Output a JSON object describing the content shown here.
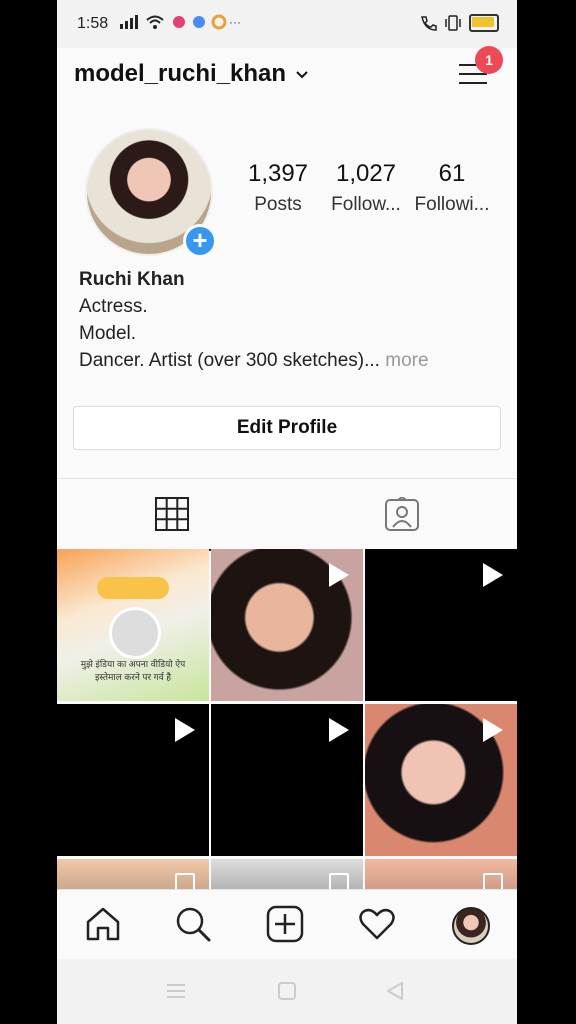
{
  "status_bar": {
    "time": "1:58"
  },
  "profile": {
    "username": "model_ruchi_khan",
    "notification_count": "1",
    "stats": [
      {
        "value": "1,397",
        "label": "Posts"
      },
      {
        "value": "1,027",
        "label": "Follow..."
      },
      {
        "value": "61",
        "label": "Followi..."
      }
    ],
    "display_name": "Ruchi Khan",
    "bio_lines": [
      "Actress.",
      "Model.",
      "Dancer. Artist (over 300 sketches)..."
    ],
    "bio_more": "more",
    "edit_profile_label": "Edit Profile"
  },
  "posts": {
    "roposo_text": "मुझे इंडिया का अपना वीडियो ऐप इस्तेमाल करने पर गर्व है"
  },
  "icons": {
    "statusbar": [
      "signal-icon",
      "wifi-icon",
      "notification-icons",
      "call-icon",
      "vibrate-icon",
      "battery-icon"
    ],
    "header": [
      "chevron-down-icon",
      "hamburger-menu-icon"
    ],
    "tabs": [
      "grid-icon",
      "tagged-person-icon"
    ],
    "bottom_nav": [
      "home-icon",
      "search-icon",
      "add-post-icon",
      "heart-icon",
      "profile-avatar"
    ]
  },
  "colors": {
    "badge": "#ed4956",
    "add_button": "#3897f0"
  }
}
